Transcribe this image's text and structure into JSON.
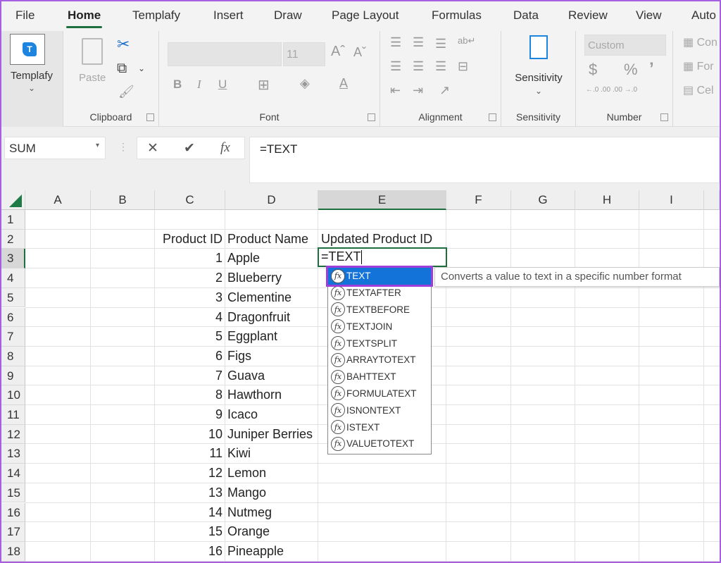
{
  "ribbon_tabs": [
    {
      "label": "File",
      "active": false
    },
    {
      "label": "Home",
      "active": true
    },
    {
      "label": "Templafy",
      "active": false
    },
    {
      "label": "Insert",
      "active": false
    },
    {
      "label": "Draw",
      "active": false
    },
    {
      "label": "Page Layout",
      "active": false
    },
    {
      "label": "Formulas",
      "active": false
    },
    {
      "label": "Data",
      "active": false
    },
    {
      "label": "Review",
      "active": false
    },
    {
      "label": "View",
      "active": false
    },
    {
      "label": "Auto",
      "active": false
    }
  ],
  "ribbon": {
    "templafy": {
      "label": "Templafy",
      "logo": "T"
    },
    "clipboard": {
      "label": "Clipboard",
      "paste": "Paste"
    },
    "font": {
      "label": "Font",
      "font_name": "",
      "font_size": "11",
      "bold": "B",
      "italic": "I",
      "underline": "U",
      "grow": "Aˆ",
      "shrink": "Aˇ",
      "font_color": "A"
    },
    "alignment": {
      "label": "Alignment"
    },
    "sensitivity": {
      "label": "Sensitivity",
      "button": "Sensitivity"
    },
    "number": {
      "label": "Number",
      "format": "Custom",
      "currency": "$",
      "percent": "%",
      "comma": "’",
      "inc_decimal": "←.0 .00",
      "dec_decimal": ".00 →.0"
    },
    "styles": {
      "conditional": "Con",
      "format_table": "For",
      "cell_styles": "Cel"
    }
  },
  "formula_bar": {
    "name_box": "SUM",
    "cancel": "✕",
    "enter": "✔",
    "fx": "fx",
    "formula": "=TEXT"
  },
  "columns": [
    "A",
    "B",
    "C",
    "D",
    "E",
    "F",
    "G",
    "H",
    "I"
  ],
  "selected_column": "E",
  "rows": [
    "1",
    "2",
    "3",
    "4",
    "5",
    "6",
    "7",
    "8",
    "9",
    "10",
    "11",
    "12",
    "13",
    "14",
    "15",
    "16",
    "17",
    "18"
  ],
  "selected_row": "3",
  "headers": {
    "c": "Product ID",
    "d": "Product Name",
    "e": "Updated Product ID"
  },
  "data_rows": [
    {
      "id": "1",
      "name": "Apple"
    },
    {
      "id": "2",
      "name": "Blueberry"
    },
    {
      "id": "3",
      "name": "Clementine"
    },
    {
      "id": "4",
      "name": "Dragonfruit"
    },
    {
      "id": "5",
      "name": "Eggplant"
    },
    {
      "id": "6",
      "name": "Figs"
    },
    {
      "id": "7",
      "name": "Guava"
    },
    {
      "id": "8",
      "name": "Hawthorn"
    },
    {
      "id": "9",
      "name": "Icaco"
    },
    {
      "id": "10",
      "name": "Juniper Berries"
    },
    {
      "id": "11",
      "name": "Kiwi"
    },
    {
      "id": "12",
      "name": "Lemon"
    },
    {
      "id": "13",
      "name": "Mango"
    },
    {
      "id": "14",
      "name": "Nutmeg"
    },
    {
      "id": "15",
      "name": "Orange"
    },
    {
      "id": "16",
      "name": "Pineapple"
    }
  ],
  "active_cell_value": "=TEXT",
  "autocomplete": {
    "items": [
      "TEXT",
      "TEXTAFTER",
      "TEXTBEFORE",
      "TEXTJOIN",
      "TEXTSPLIT",
      "ARRAYTOTEXT",
      "BAHTTEXT",
      "FORMULATEXT",
      "ISNONTEXT",
      "ISTEXT",
      "VALUETOTEXT"
    ],
    "selected": "TEXT",
    "icon": "fx",
    "tooltip": "Converts a value to text in a specific number format"
  },
  "colors": {
    "accent_green": "#1e6f3e",
    "highlight_purple": "#9b3fd8",
    "selection_blue": "#1373d8"
  }
}
